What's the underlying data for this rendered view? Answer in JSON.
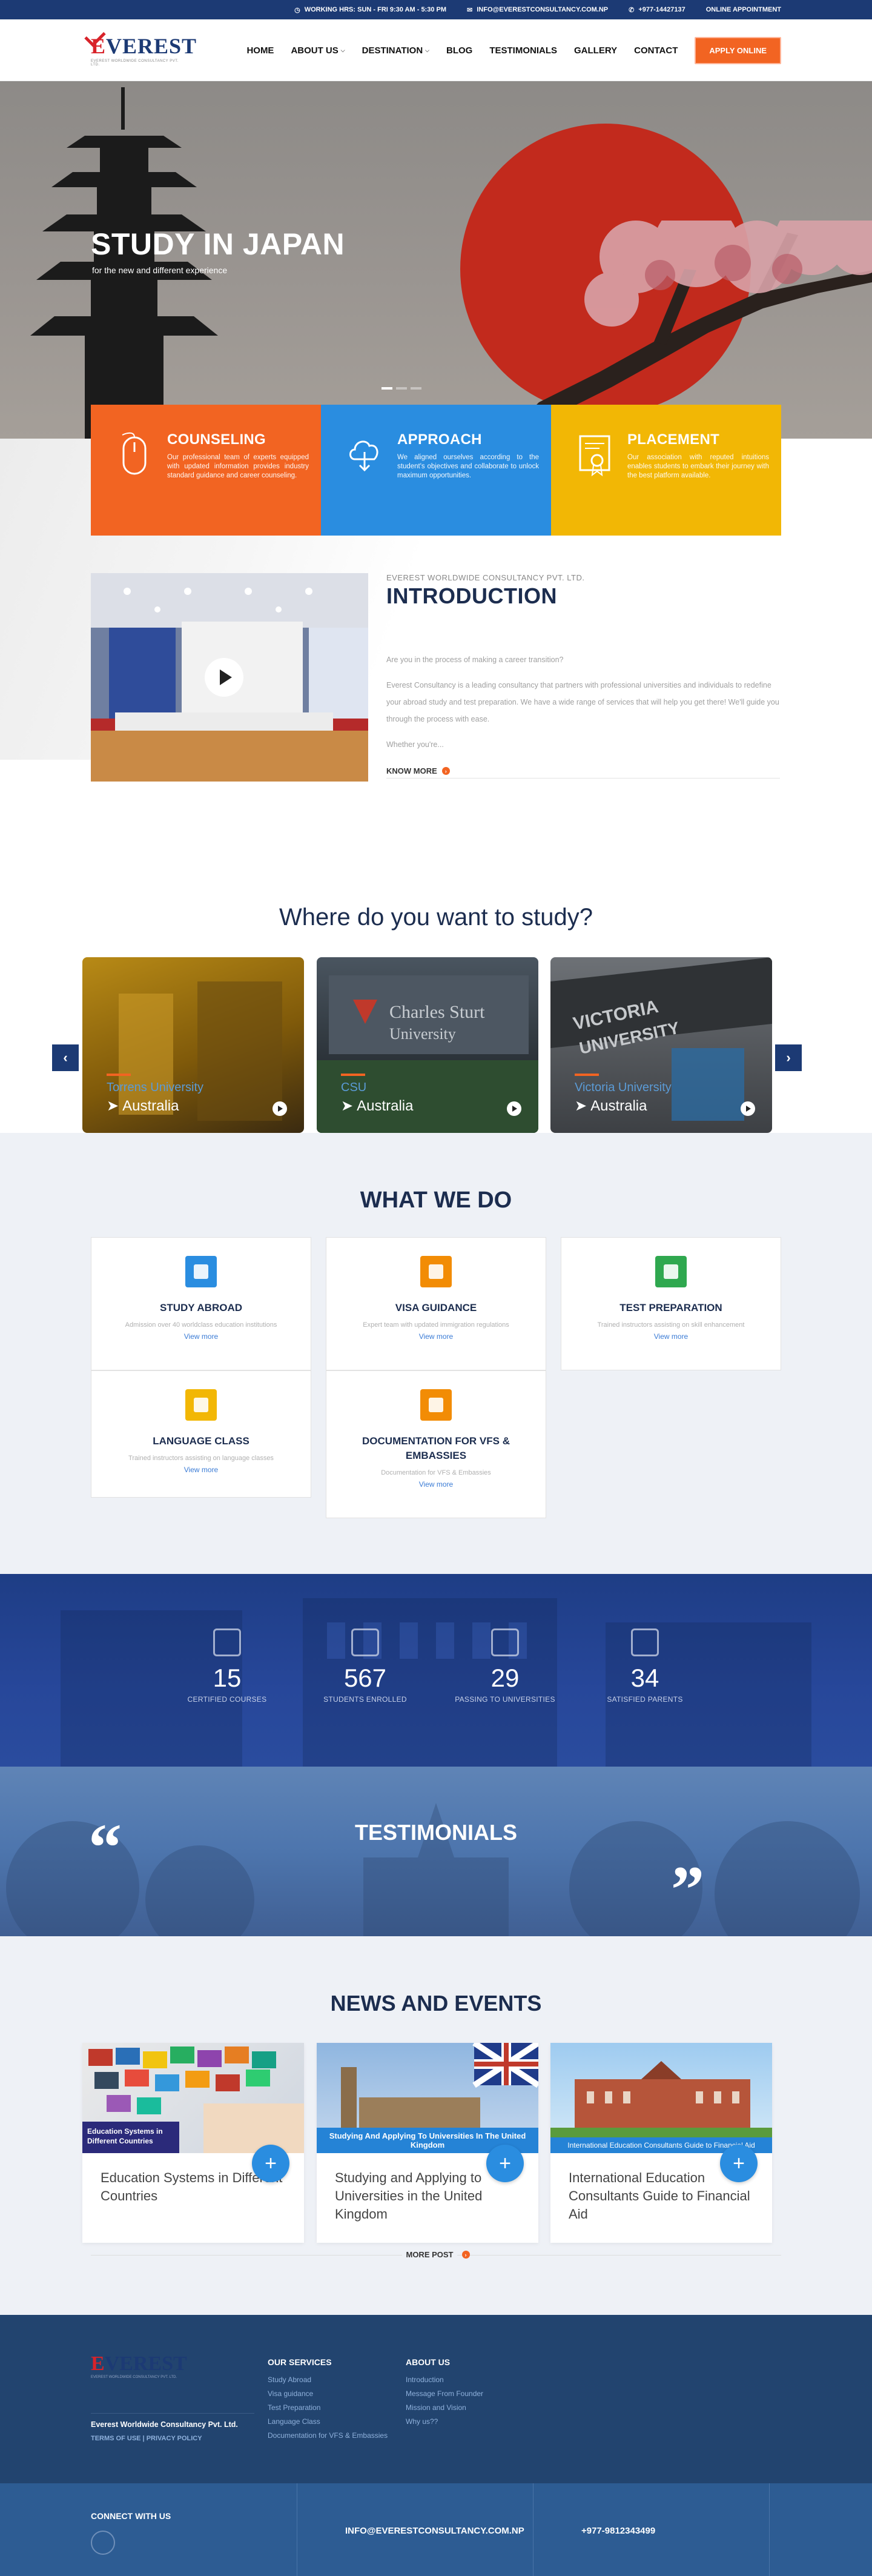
{
  "topbar": {
    "hours": "WORKING HRS: SUN - FRI 9:30 AM - 5:30 PM",
    "email": "INFO@EVERESTCONSULTANCY.COM.NP",
    "phone": "+977-14427137",
    "appointment": "ONLINE APPOINTMENT"
  },
  "logo": {
    "text_e": "E",
    "text_rest": "VEREST",
    "tagline": "EVEREST WORLDWIDE CONSULTANCY PVT. LTD."
  },
  "nav": {
    "home": "HOME",
    "about": "ABOUT US",
    "destination": "DESTINATION",
    "blog": "BLOG",
    "testimonials": "TESTIMONIALS",
    "gallery": "GALLERY",
    "contact": "CONTACT",
    "apply": "APPLY ONLINE"
  },
  "hero": {
    "title": "STUDY IN JAPAN",
    "subtitle": "for the new and different experience"
  },
  "features": [
    {
      "title": "COUNSELING",
      "text": "Our professional team of experts equipped with updated information provides industry standard guidance and career counseling.",
      "color": "#f26422"
    },
    {
      "title": "APPROACH",
      "text": "We aligned ourselves according to the student's objectives and collaborate to unlock maximum opportunities.",
      "color": "#2a8de0"
    },
    {
      "title": "PLACEMENT",
      "text": "Our association with reputed intuitions enables students to embark their journey with the best platform available.",
      "color": "#f2b705"
    }
  ],
  "intro": {
    "kicker": "EVEREST WORLDWIDE CONSULTANCY PVT. LTD.",
    "title": "INTRODUCTION",
    "p1": "Are you in the process of making a career transition?",
    "p2": "Everest Consultancy is a leading consultancy that partners with professional universities and individuals to redefine your abroad study and test preparation. We have a wide range of services that will help you get there! We'll guide you through the process with ease.",
    "p3": "Whether you're...",
    "more": "KNOW MORE"
  },
  "where": {
    "title": "Where do you want to study?",
    "unis": [
      {
        "name": "Torrens University",
        "country": "Australia"
      },
      {
        "name": "CSU",
        "country": "Australia"
      },
      {
        "name": "Victoria University",
        "country": "Australia"
      }
    ]
  },
  "wwd": {
    "title": "WHAT WE DO",
    "cards": [
      {
        "title": "STUDY ABROAD",
        "text": "Admission over 40 worldclass education institutions",
        "more": "View more",
        "color": "#2a8de0"
      },
      {
        "title": "VISA GUIDANCE",
        "text": "Expert team with updated immigration regulations",
        "more": "View more",
        "color": "#f28c05"
      },
      {
        "title": "TEST PREPARATION",
        "text": "Trained instructors assisting on skill enhancement",
        "more": "View more",
        "color": "#2fa84f"
      },
      {
        "title": "LANGUAGE CLASS",
        "text": "Trained instructors assisting on language classes",
        "more": "View more",
        "color": "#f2b705"
      },
      {
        "title": "DOCUMENTATION FOR VFS & EMBASSIES",
        "text": "Documentation for VFS & Embassies",
        "more": "View more",
        "color": "#f28c05"
      }
    ]
  },
  "stats": [
    {
      "n": "15",
      "l": "CERTIFIED COURSES"
    },
    {
      "n": "567",
      "l": "STUDENTS ENROLLED"
    },
    {
      "n": "29",
      "l": "PASSING TO UNIVERSITIES"
    },
    {
      "n": "34",
      "l": "SATISFIED PARENTS"
    }
  ],
  "testimonials": {
    "title": "TESTIMONIALS",
    "open": "“",
    "close": "”"
  },
  "news": {
    "title": "NEWS AND EVENTS",
    "items": [
      {
        "tag": "Education Systems in Different Countries",
        "title": "Education Systems in Different Countries"
      },
      {
        "tag": "Studying And Applying To Universities In The United Kingdom",
        "title": "Studying and Applying to Universities in the United Kingdom"
      },
      {
        "tag": "International Education Consultants Guide to Financial Aid",
        "title": "International Education Consultants Guide to Financial Aid"
      }
    ],
    "more": "MORE POST"
  },
  "footer": {
    "company": "Everest Worldwide Consultancy Pvt. Ltd.",
    "terms": "TERMS OF USE | PRIVACY POLICY",
    "services_title": "OUR SERVICES",
    "services": [
      "Study Abroad",
      "Visa guidance",
      "Test Preparation",
      "Language Class",
      "Documentation for VFS & Embassies"
    ],
    "about_title": "ABOUT US",
    "about": [
      "Introduction",
      "Message From Founder",
      "Mission and Vision",
      "Why us??"
    ],
    "connect": "CONNECT WITH US",
    "email": "INFO@EVERESTCONSULTANCY.COM.NP",
    "phone": "+977-9812343499"
  }
}
